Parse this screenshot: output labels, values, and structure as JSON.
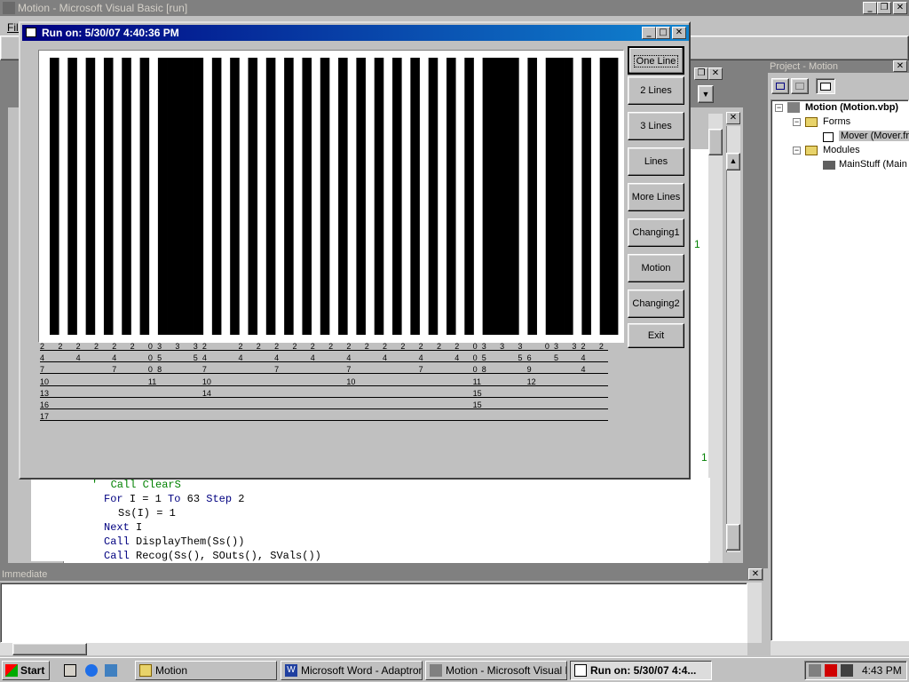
{
  "app": {
    "title": "Motion - Microsoft Visual Basic [run]",
    "menu_file": "File"
  },
  "form": {
    "title": "Run on: 5/30/07  4:40:36 PM",
    "buttons": [
      "One Line",
      "2 Lines",
      "3 Lines",
      "Lines",
      "More Lines",
      "Changing1",
      "Motion",
      "Changing2",
      "Exit"
    ]
  },
  "levels": [
    {
      "label": "2",
      "marks": [
        {
          "col": 0,
          "t": "2"
        },
        {
          "col": 2,
          "t": "2"
        },
        {
          "col": 4,
          "t": "2"
        },
        {
          "col": 6,
          "t": "2"
        },
        {
          "col": 8,
          "t": "2"
        },
        {
          "col": 10,
          "t": "2"
        },
        {
          "col": 12,
          "t": "0"
        },
        {
          "col": 13,
          "t": "3"
        },
        {
          "col": 15,
          "t": "3"
        },
        {
          "col": 17,
          "t": "3"
        },
        {
          "col": 18,
          "t": "2"
        },
        {
          "col": 22,
          "t": "2"
        },
        {
          "col": 24,
          "t": "2"
        },
        {
          "col": 26,
          "t": "2"
        },
        {
          "col": 28,
          "t": "2"
        },
        {
          "col": 30,
          "t": "2"
        },
        {
          "col": 32,
          "t": "2"
        },
        {
          "col": 34,
          "t": "2"
        },
        {
          "col": 36,
          "t": "2"
        },
        {
          "col": 38,
          "t": "2"
        },
        {
          "col": 40,
          "t": "2"
        },
        {
          "col": 42,
          "t": "2"
        },
        {
          "col": 44,
          "t": "2"
        },
        {
          "col": 46,
          "t": "2"
        },
        {
          "col": 48,
          "t": "0"
        },
        {
          "col": 49,
          "t": "3"
        },
        {
          "col": 51,
          "t": "3"
        },
        {
          "col": 53,
          "t": "3"
        },
        {
          "col": 56,
          "t": "0"
        },
        {
          "col": 57,
          "t": "3"
        },
        {
          "col": 59,
          "t": "3"
        },
        {
          "col": 60,
          "t": "2"
        },
        {
          "col": 62,
          "t": "2"
        }
      ]
    },
    {
      "label": "4",
      "marks": [
        {
          "col": 0,
          "t": "4"
        },
        {
          "col": 4,
          "t": "4"
        },
        {
          "col": 8,
          "t": "4"
        },
        {
          "col": 12,
          "t": "0"
        },
        {
          "col": 13,
          "t": "5"
        },
        {
          "col": 17,
          "t": "5"
        },
        {
          "col": 18,
          "t": "4"
        },
        {
          "col": 22,
          "t": "4"
        },
        {
          "col": 26,
          "t": "4"
        },
        {
          "col": 30,
          "t": "4"
        },
        {
          "col": 34,
          "t": "4"
        },
        {
          "col": 38,
          "t": "4"
        },
        {
          "col": 42,
          "t": "4"
        },
        {
          "col": 46,
          "t": "4"
        },
        {
          "col": 48,
          "t": "0"
        },
        {
          "col": 49,
          "t": "5"
        },
        {
          "col": 53,
          "t": "5"
        },
        {
          "col": 54,
          "t": "6"
        },
        {
          "col": 57,
          "t": "5"
        },
        {
          "col": 60,
          "t": "4"
        }
      ]
    },
    {
      "label": "7",
      "marks": [
        {
          "col": 0,
          "t": "7"
        },
        {
          "col": 8,
          "t": "7"
        },
        {
          "col": 12,
          "t": "0"
        },
        {
          "col": 13,
          "t": "8"
        },
        {
          "col": 18,
          "t": "7"
        },
        {
          "col": 26,
          "t": "7"
        },
        {
          "col": 34,
          "t": "7"
        },
        {
          "col": 42,
          "t": "7"
        },
        {
          "col": 48,
          "t": "0"
        },
        {
          "col": 49,
          "t": "8"
        },
        {
          "col": 54,
          "t": "9"
        },
        {
          "col": 60,
          "t": "4"
        }
      ]
    },
    {
      "label": "10",
      "marks": [
        {
          "col": 0,
          "t": "10"
        },
        {
          "col": 12,
          "t": "11"
        },
        {
          "col": 18,
          "t": "10"
        },
        {
          "col": 34,
          "t": "10"
        },
        {
          "col": 48,
          "t": "11"
        },
        {
          "col": 54,
          "t": "12"
        }
      ]
    },
    {
      "label": "13",
      "marks": [
        {
          "col": 0,
          "t": "13"
        },
        {
          "col": 18,
          "t": "14"
        },
        {
          "col": 48,
          "t": "15"
        }
      ]
    },
    {
      "label": "16",
      "marks": [
        {
          "col": 0,
          "t": "16"
        },
        {
          "col": 48,
          "t": "15"
        }
      ]
    },
    {
      "label": "17",
      "marks": [
        {
          "col": 0,
          "t": "17"
        }
      ]
    }
  ],
  "stripes": [
    1,
    0,
    1,
    0,
    1,
    0,
    1,
    0,
    1,
    0,
    1,
    0,
    1,
    1,
    1,
    1,
    1,
    0,
    1,
    0,
    1,
    0,
    1,
    0,
    1,
    0,
    1,
    0,
    1,
    0,
    1,
    0,
    1,
    0,
    1,
    0,
    1,
    0,
    1,
    0,
    1,
    0,
    1,
    0,
    1,
    0,
    1,
    0,
    1,
    1,
    1,
    1,
    0,
    1,
    0,
    1,
    1,
    1,
    0,
    1,
    0,
    1,
    1
  ],
  "project": {
    "title": "Project - Motion",
    "root": "Motion (Motion.vbp)",
    "forms": "Forms",
    "form_item": "Mover (Mover.fr",
    "modules": "Modules",
    "module_item": "MainStuff (Main"
  },
  "code": [
    "'  Call ClearS",
    "For I = 1 To 63 Step 2",
    "  Ss(I) = 1",
    "Next I",
    "Call DisplayThem(Ss())",
    "Call Recog(Ss(), SOuts(), SVals())"
  ],
  "code_fragments": [
    "1",
    "1"
  ],
  "immediate": {
    "title": "Immediate"
  },
  "taskbar": {
    "start": "Start",
    "tasks": [
      "Motion",
      "Microsoft Word - Adaptron ...",
      "Motion - Microsoft Visual B...",
      "Run on: 5/30/07  4:4..."
    ],
    "clock": "4:43 PM"
  }
}
